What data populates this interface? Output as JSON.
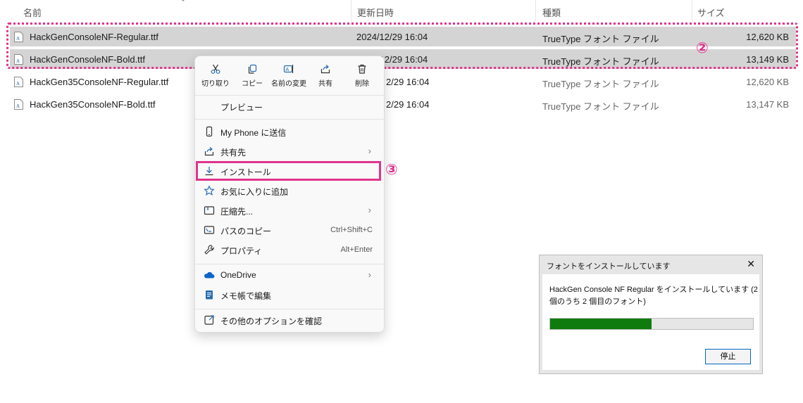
{
  "columns": {
    "name": "名前",
    "modified": "更新日時",
    "type": "種類",
    "size": "サイズ"
  },
  "files": [
    {
      "name": "HackGenConsoleNF-Regular.ttf",
      "modified": "2024/12/29 16:04",
      "type": "TrueType フォント ファイル",
      "size": "12,620 KB"
    },
    {
      "name": "HackGenConsoleNF-Bold.ttf",
      "modified": "2024/12/29 16:04",
      "type": "TrueType フォント ファイル",
      "size": "13,149 KB"
    },
    {
      "name": "HackGen35ConsoleNF-Regular.ttf",
      "modified": "2/29 16:04",
      "type": "TrueType フォント ファイル",
      "size": "12,620 KB"
    },
    {
      "name": "HackGen35ConsoleNF-Bold.ttf",
      "modified": "2/29 16:04",
      "type": "TrueType フォント ファイル",
      "size": "13,147 KB"
    }
  ],
  "annotations": {
    "step2": "②",
    "step3": "③",
    "color": "#e0338c"
  },
  "context_menu": {
    "quick_actions": [
      {
        "label": "切り取り",
        "icon": "scissors-icon"
      },
      {
        "label": "コピー",
        "icon": "copy-icon"
      },
      {
        "label": "名前の変更",
        "icon": "rename-icon"
      },
      {
        "label": "共有",
        "icon": "share-icon"
      },
      {
        "label": "削除",
        "icon": "trash-icon"
      }
    ],
    "preview": "プレビュー",
    "send_phone": "My Phone に送信",
    "share_to": "共有先",
    "install": "インストール",
    "favorite": "お気に入りに追加",
    "compress": "圧縮先...",
    "copy_path": "パスのコピー",
    "copy_path_shortcut": "Ctrl+Shift+C",
    "properties": "プロパティ",
    "properties_shortcut": "Alt+Enter",
    "onedrive": "OneDrive",
    "notepad": "メモ帳で編集",
    "more_options": "その他のオプションを確認"
  },
  "dialog": {
    "title": "フォントをインストールしています",
    "message": "HackGen Console NF Regular をインストールしています (2 個のうち 2 個目のフォント)",
    "progress": 0.5,
    "stop_button": "停止",
    "progress_color": "#0f7b0f"
  }
}
